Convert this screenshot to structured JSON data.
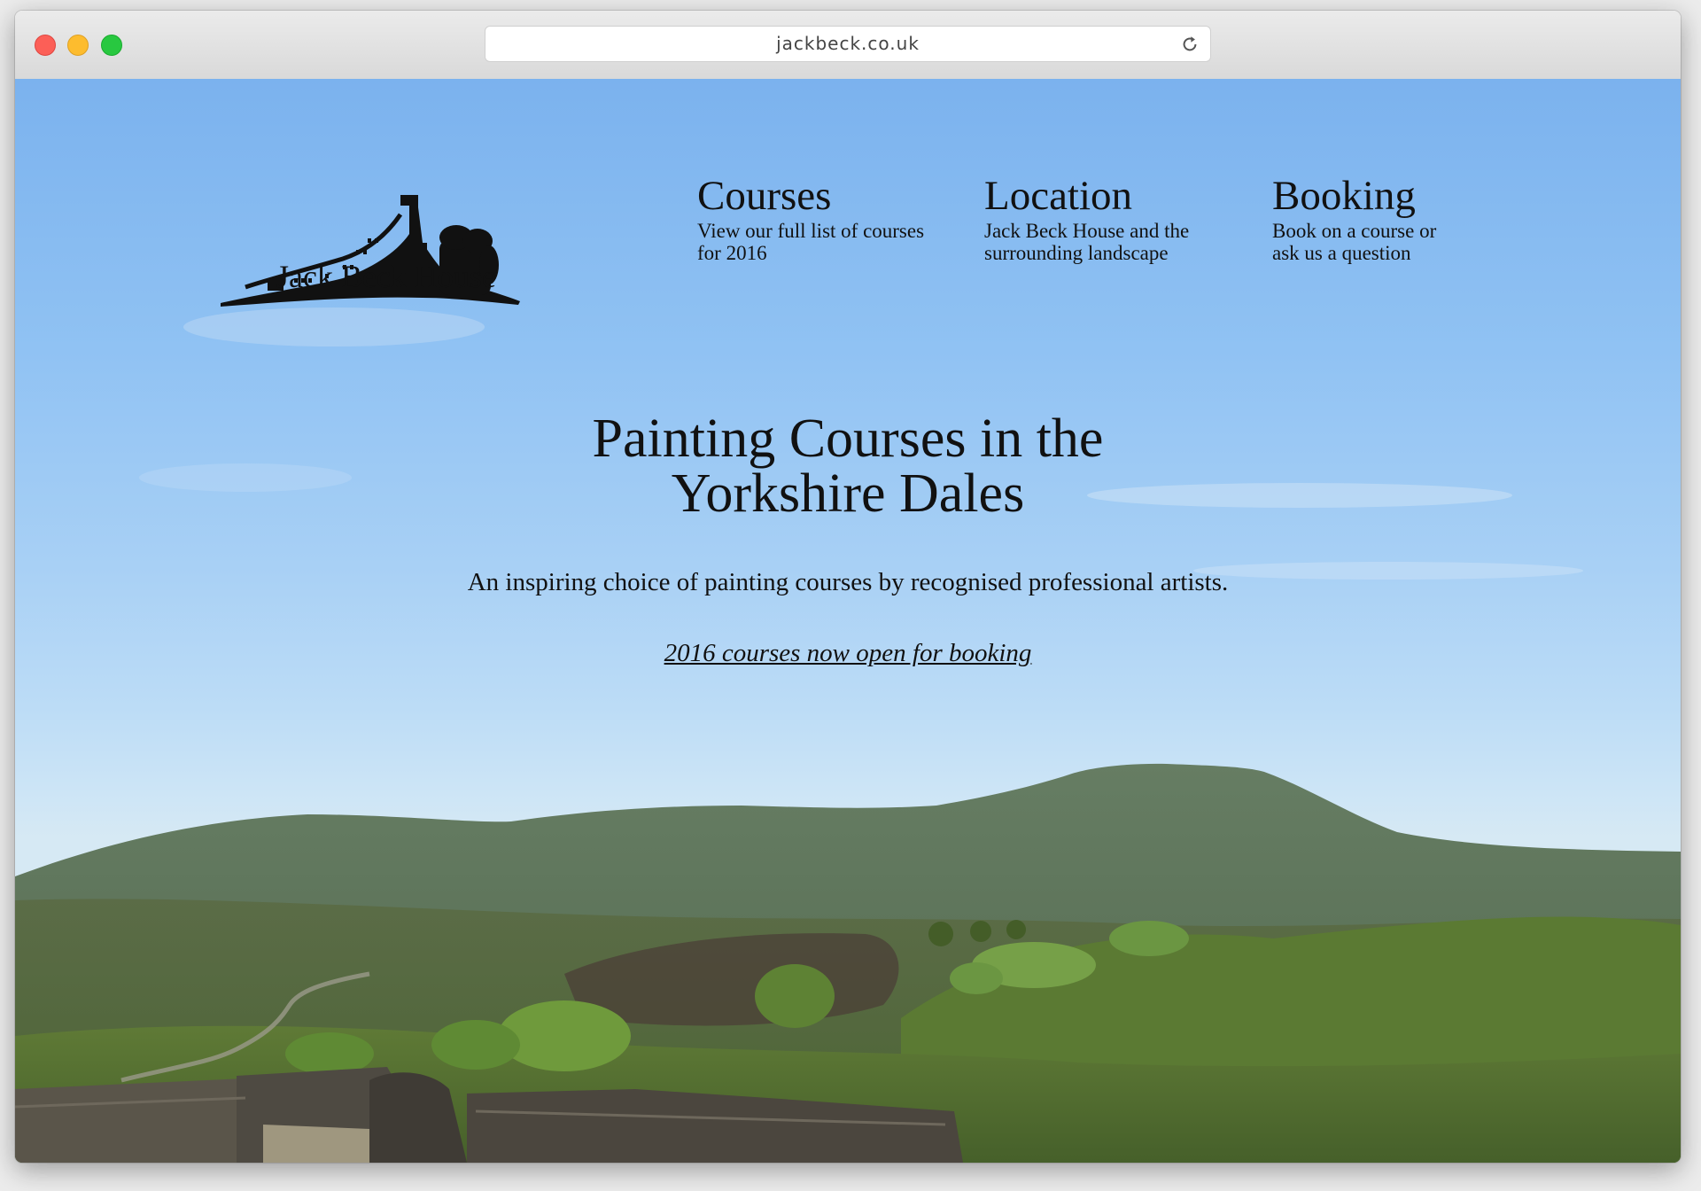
{
  "browser": {
    "url": "jackbeck.co.uk"
  },
  "site": {
    "logo_text": "Jack Beck House"
  },
  "nav": {
    "items": [
      {
        "title": "Courses",
        "desc": "View our full list of courses for 2016"
      },
      {
        "title": "Location",
        "desc": "Jack Beck House and the surrounding landscape"
      },
      {
        "title": "Booking",
        "desc": "Book on a course or ask us a question"
      }
    ]
  },
  "hero": {
    "title_line1": "Painting Courses in the",
    "title_line2": "Yorkshire Dales",
    "subtitle": "An inspiring choice of painting courses by recognised professional artists.",
    "link": "2016 courses now open for booking"
  },
  "colors": {
    "sky_top": "#7bb2ee",
    "sky_bottom": "#d6e9f4",
    "hills": "#5c7458",
    "moor": "#5a6e3e",
    "text": "#111111"
  }
}
